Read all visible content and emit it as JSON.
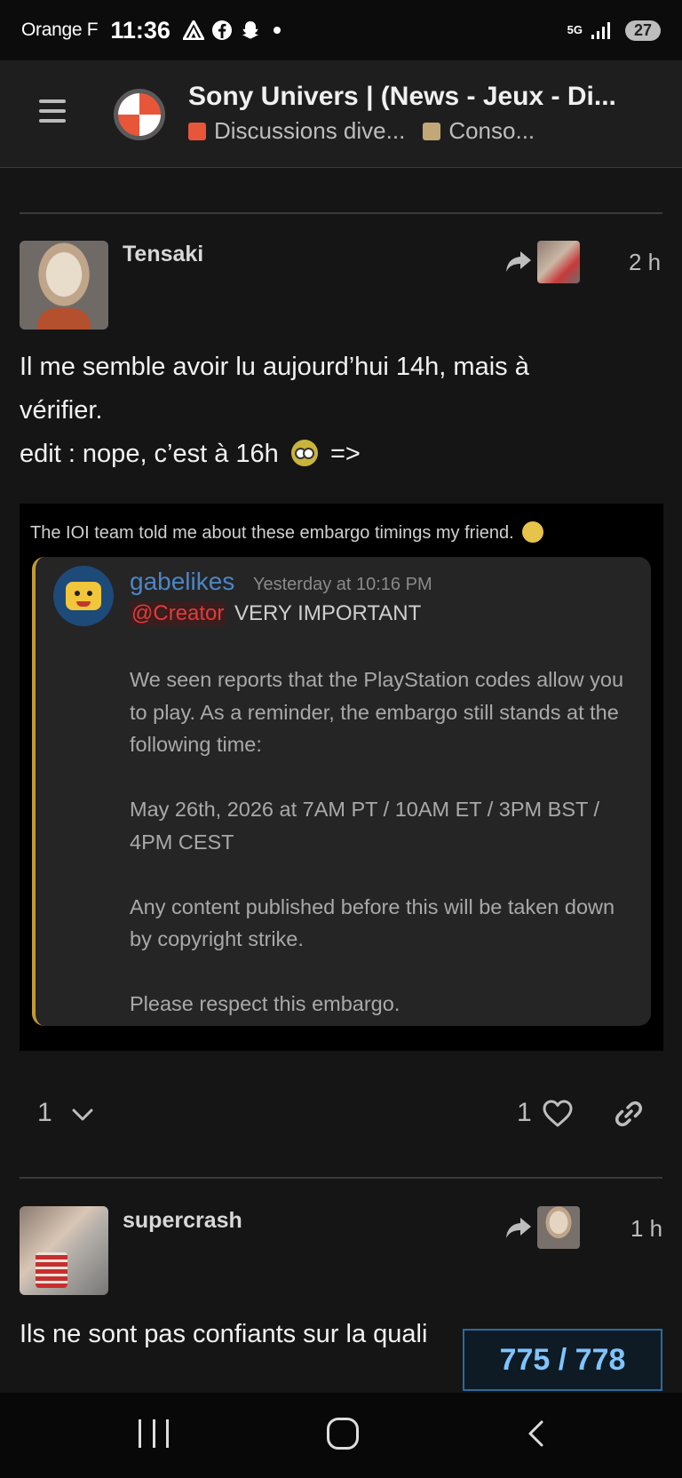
{
  "status_bar": {
    "carrier": "Orange F",
    "time": "11:36",
    "network": "5G",
    "battery": "27"
  },
  "header": {
    "title": "Sony Univers | (News - Jeux - Di...",
    "categories": [
      {
        "label": "Discussions dive...",
        "color": "#e8563a"
      },
      {
        "label": "Conso...",
        "color": "#c2a878"
      }
    ]
  },
  "posts": [
    {
      "username": "Tensaki",
      "time": "2 h",
      "text_line1": "Il me semble avoir lu aujourd’hui 14h, mais à",
      "text_line2": "vérifier.",
      "text_line3_prefix": "edit : nope, c’est à 16h",
      "text_line3_suffix": "=>",
      "embed": {
        "caption": "The IOI team told me about these embargo timings my friend.",
        "author": "gabelikes",
        "timestamp": "Yesterday at 10:16 PM",
        "mention": "@Creator",
        "headline": "VERY IMPORTANT",
        "paragraphs": [
          "We seen reports that the PlayStation codes allow you to play. As a reminder, the embargo still stands at the following time:",
          "May 26th, 2026 at 7AM PT / 10AM ET / 3PM BST / 4PM CEST",
          "Any content published before this will be taken down by copyright strike.",
          "Please respect this embargo."
        ]
      },
      "actions": {
        "replies_count": "1",
        "likes_count": "1"
      }
    },
    {
      "username": "supercrash",
      "time": "1 h",
      "text_line1": "Ils ne sont pas confiants sur la quali"
    }
  ],
  "progress": "775 / 778"
}
